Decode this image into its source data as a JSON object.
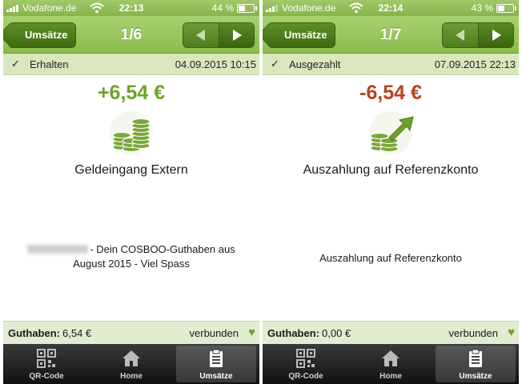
{
  "status_bar": {
    "carrier": "Vodafone.de",
    "left_time": "22:13",
    "right_time": "22:14",
    "left_battery": "44 %",
    "right_battery": "43 %"
  },
  "nav": {
    "back_label": "Umsätze",
    "left_position": "1/6",
    "right_position": "1/7"
  },
  "transactions": [
    {
      "status": "Erhalten",
      "date": "04.09.2015 10:15",
      "amount": "+6,54 €",
      "title": "Geldeingang Extern",
      "description_line1": "- Dein COSBOO-Guthaben aus",
      "description_line2": "August 2015 - Viel Spass",
      "icon": "coins-stack-icon"
    },
    {
      "status": "Ausgezahlt",
      "date": "07.09.2015 22:13",
      "amount": "-6,54 €",
      "title": "Auszahlung auf Referenzkonto",
      "description": "Auszahlung auf Referenzkonto",
      "icon": "coins-payout-arrow-icon"
    }
  ],
  "balance": {
    "label": "Guthaben:",
    "left_value": "6,54 €",
    "right_value": "0,00 €",
    "connection": "verbunden"
  },
  "tabs": [
    {
      "label": "QR-Code",
      "icon": "qr-code-icon"
    },
    {
      "label": "Home",
      "icon": "home-icon"
    },
    {
      "label": "Umsätze",
      "icon": "clipboard-icon"
    }
  ],
  "colors": {
    "brand_green": "#8cbc4c",
    "positive": "#6fa32a",
    "negative": "#b7421f"
  }
}
